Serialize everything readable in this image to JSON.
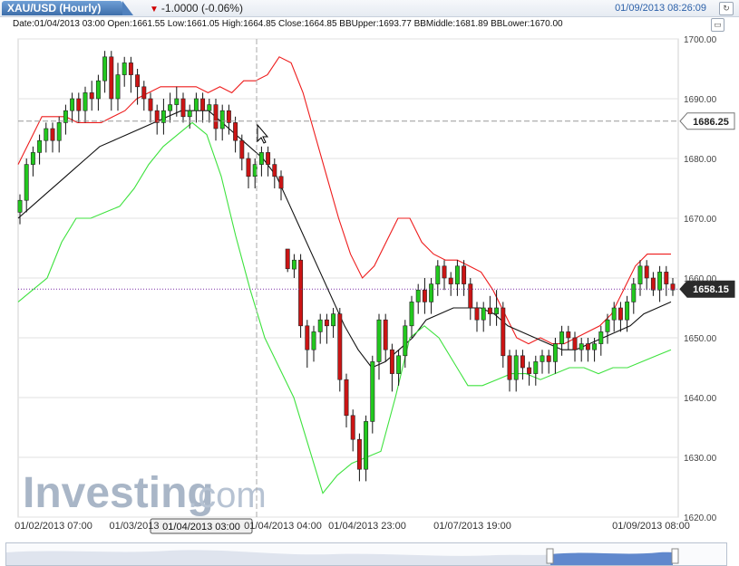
{
  "header": {
    "symbol": "XAU/USD (Hourly)",
    "change": "-1.0000 (-0.06%)",
    "datetime": "01/09/2013 08:26:09"
  },
  "info": "Date:01/04/2013 03:00 Open:1661.55 Low:1661.05 High:1664.85 Close:1664.85 BBUpper:1693.77 BBMiddle:1681.89 BBLower:1670.00",
  "watermark": {
    "brand": "Investing",
    "suffix": ".com"
  },
  "cursor_x_label": "01/04/2013 03:00",
  "colors": {
    "up": "#22c81e",
    "down": "#cc1414",
    "bb_upper": "#ee1c1c",
    "bb_middle": "#111111",
    "bb_lower": "#3ee23e",
    "grid": "#e2e2e2"
  },
  "chart_data": {
    "type": "candlestick",
    "ylim": [
      1620,
      1700
    ],
    "y_ticks": [
      "1620.00",
      "1630.00",
      "1640.00",
      "1650.00",
      "1660.00",
      "1670.00",
      "1680.00",
      "1690.00",
      "1700.00"
    ],
    "x_tick_labels": [
      "01/02/2013 07:00",
      "01/03/2013",
      "01/04/2013 04:00",
      "01/04/2013 23:00",
      "01/07/2013 19:00",
      "01/09/2013 08:00"
    ],
    "price_labels": {
      "crosshair": "1686.25",
      "last": "1658.15"
    },
    "candles": [
      [
        1671,
        1673,
        1670,
        1674,
        1669
      ],
      [
        1673,
        1679,
        1672,
        1680,
        1671
      ],
      [
        1679,
        1681,
        1678,
        1682,
        1677
      ],
      [
        1681,
        1683,
        1680,
        1684,
        1679
      ],
      [
        1683,
        1685,
        1682,
        1686,
        1681
      ],
      [
        1685,
        1683,
        1682,
        1686,
        1681
      ],
      [
        1683,
        1686,
        1682,
        1687,
        1681
      ],
      [
        1686,
        1688,
        1685,
        1689,
        1684
      ],
      [
        1688,
        1690,
        1687,
        1691,
        1686
      ],
      [
        1690,
        1688,
        1687,
        1691,
        1686
      ],
      [
        1688,
        1691,
        1687,
        1692,
        1686
      ],
      [
        1691,
        1690,
        1689,
        1693,
        1688
      ],
      [
        1690,
        1693,
        1689,
        1694,
        1688
      ],
      [
        1693,
        1697,
        1692,
        1698,
        1691
      ],
      [
        1697,
        1690,
        1689,
        1698,
        1688
      ],
      [
        1690,
        1694,
        1689,
        1696,
        1688
      ],
      [
        1694,
        1696,
        1693,
        1697,
        1692
      ],
      [
        1696,
        1694,
        1692,
        1697,
        1691
      ],
      [
        1694,
        1692,
        1690,
        1695,
        1689
      ],
      [
        1692,
        1690,
        1688,
        1693,
        1688
      ],
      [
        1690,
        1688,
        1687,
        1691,
        1686
      ],
      [
        1688,
        1686,
        1685,
        1689,
        1684
      ],
      [
        1686,
        1688,
        1685,
        1690,
        1684
      ],
      [
        1688,
        1689,
        1687,
        1691,
        1686
      ],
      [
        1689,
        1690,
        1688,
        1692,
        1687
      ],
      [
        1690,
        1687,
        1686,
        1691,
        1686
      ],
      [
        1687,
        1688,
        1686,
        1689,
        1685
      ],
      [
        1688,
        1690,
        1687,
        1691,
        1686
      ],
      [
        1690,
        1688,
        1686,
        1691,
        1686
      ],
      [
        1688,
        1689,
        1687,
        1690,
        1686
      ],
      [
        1689,
        1685,
        1684,
        1690,
        1683
      ],
      [
        1685,
        1688,
        1684,
        1689,
        1683
      ],
      [
        1688,
        1686,
        1685,
        1689,
        1684
      ],
      [
        1686,
        1683,
        1682,
        1687,
        1681
      ],
      [
        1683,
        1680,
        1679,
        1684,
        1678
      ],
      [
        1680,
        1677,
        1676,
        1681,
        1675
      ],
      [
        1677,
        1679,
        1676,
        1680,
        1675
      ],
      [
        1679,
        1681,
        1678,
        1682,
        1677
      ],
      [
        1681,
        1679,
        1678,
        1682,
        1677
      ],
      [
        1679,
        1677,
        1676,
        1680,
        1675
      ],
      [
        1677,
        1675,
        1674,
        1678,
        1673
      ],
      [
        1664.85,
        1661.55,
        1661.05,
        1664.85,
        1661
      ],
      [
        1661.5,
        1663,
        1660.5,
        1664,
        1660
      ],
      [
        1663,
        1652,
        1651,
        1664,
        1650
      ],
      [
        1652,
        1648,
        1646,
        1653,
        1645
      ],
      [
        1648,
        1651,
        1647,
        1652,
        1646
      ],
      [
        1651,
        1653,
        1650,
        1654,
        1649
      ],
      [
        1653,
        1652,
        1650,
        1654,
        1649
      ],
      [
        1652,
        1654,
        1651,
        1655,
        1650
      ],
      [
        1654,
        1643,
        1642,
        1655,
        1641
      ],
      [
        1643,
        1637,
        1636,
        1644,
        1635
      ],
      [
        1637,
        1633,
        1632,
        1638,
        1631
      ],
      [
        1633,
        1628,
        1627,
        1634,
        1626
      ],
      [
        1628,
        1636,
        1627,
        1637,
        1626
      ],
      [
        1636,
        1646,
        1635,
        1647,
        1634
      ],
      [
        1646,
        1653,
        1645,
        1654,
        1643
      ],
      [
        1653,
        1648,
        1647,
        1654,
        1646
      ],
      [
        1648,
        1644,
        1642,
        1649,
        1641
      ],
      [
        1644,
        1647,
        1643,
        1648,
        1642
      ],
      [
        1647,
        1652,
        1646,
        1653,
        1645
      ],
      [
        1652,
        1656,
        1651,
        1657,
        1650
      ],
      [
        1656,
        1658,
        1655,
        1659,
        1654
      ],
      [
        1658,
        1656,
        1655,
        1660,
        1654
      ],
      [
        1656,
        1659,
        1655,
        1660,
        1654
      ],
      [
        1659,
        1662,
        1658,
        1663,
        1657
      ],
      [
        1662,
        1660,
        1659,
        1663,
        1658
      ],
      [
        1660,
        1659,
        1658,
        1661,
        1657
      ],
      [
        1659,
        1662,
        1658,
        1663,
        1657
      ],
      [
        1662,
        1659,
        1658,
        1663,
        1657
      ],
      [
        1659,
        1655,
        1654,
        1660,
        1653
      ],
      [
        1655,
        1653,
        1652,
        1656,
        1651
      ],
      [
        1653,
        1655,
        1652,
        1656,
        1651
      ],
      [
        1655,
        1654,
        1653,
        1657,
        1652
      ],
      [
        1654,
        1655,
        1653,
        1658,
        1652
      ],
      [
        1655,
        1647,
        1646,
        1656,
        1645
      ],
      [
        1647,
        1643,
        1642,
        1648,
        1641
      ],
      [
        1643,
        1647,
        1642,
        1648,
        1641
      ],
      [
        1647,
        1645,
        1644,
        1648,
        1643
      ],
      [
        1645,
        1644,
        1643,
        1646,
        1642
      ],
      [
        1644,
        1646,
        1643,
        1647,
        1642
      ],
      [
        1646,
        1647,
        1645,
        1648,
        1644
      ],
      [
        1647,
        1646,
        1645,
        1648,
        1644
      ],
      [
        1646,
        1649,
        1645,
        1650,
        1644
      ],
      [
        1649,
        1651,
        1648,
        1652,
        1647
      ],
      [
        1651,
        1650,
        1649,
        1652,
        1648
      ],
      [
        1650,
        1648,
        1647,
        1651,
        1646
      ],
      [
        1648,
        1649,
        1647,
        1650,
        1646
      ],
      [
        1649,
        1648,
        1647,
        1650,
        1646
      ],
      [
        1648,
        1649,
        1647,
        1650,
        1646
      ],
      [
        1649,
        1651,
        1648,
        1652,
        1647
      ],
      [
        1651,
        1653,
        1650,
        1654,
        1649
      ],
      [
        1653,
        1655,
        1652,
        1656,
        1651
      ],
      [
        1655,
        1653,
        1652,
        1656,
        1651
      ],
      [
        1653,
        1656,
        1652,
        1657,
        1651
      ],
      [
        1656,
        1659,
        1655,
        1660,
        1654
      ],
      [
        1659,
        1662,
        1658,
        1663,
        1657
      ],
      [
        1662,
        1660,
        1659,
        1663,
        1658
      ],
      [
        1660,
        1658,
        1657,
        1661,
        1657
      ],
      [
        1658,
        1661,
        1657,
        1662,
        1656
      ],
      [
        1661,
        1659,
        1658,
        1662,
        1657
      ],
      [
        1659,
        1658,
        1657,
        1660,
        1657
      ]
    ],
    "bb_upper": [
      1679,
      1683,
      1687,
      1687,
      1687,
      1686,
      1686,
      1686,
      1687,
      1688,
      1690,
      1691,
      1692,
      1692,
      1692,
      1692,
      1691,
      1692,
      1691,
      1693,
      1693,
      1694,
      1697,
      1696,
      1691,
      1684,
      1677,
      1670,
      1664,
      1660,
      1662,
      1666,
      1670,
      1670,
      1666,
      1664,
      1663,
      1663,
      1662,
      1661,
      1658,
      1654,
      1650,
      1649,
      1650,
      1649,
      1649,
      1650,
      1651,
      1652,
      1654,
      1658,
      1662,
      1664,
      1664,
      1664
    ],
    "bb_middle": [
      1670,
      1672,
      1674,
      1676,
      1678,
      1680,
      1682,
      1683,
      1684,
      1685,
      1686,
      1687,
      1688,
      1688,
      1688,
      1686,
      1684,
      1682,
      1680,
      1677,
      1672,
      1667,
      1662,
      1657,
      1652,
      1648,
      1645,
      1646,
      1648,
      1650,
      1653,
      1654,
      1655,
      1655,
      1655,
      1654,
      1652,
      1651,
      1650,
      1649,
      1648,
      1648,
      1649,
      1650,
      1651,
      1652,
      1654,
      1655,
      1656
    ],
    "bb_lower": [
      1656,
      1658,
      1660,
      1666,
      1670,
      1670,
      1671,
      1672,
      1675,
      1679,
      1682,
      1684,
      1686,
      1684,
      1677,
      1667,
      1658,
      1650,
      1645,
      1640,
      1632,
      1624,
      1627,
      1629,
      1630,
      1631,
      1640,
      1650,
      1652,
      1650,
      1646,
      1642,
      1642,
      1643,
      1644,
      1644,
      1643,
      1644,
      1645,
      1645,
      1644,
      1645,
      1645,
      1646,
      1647,
      1648
    ]
  }
}
